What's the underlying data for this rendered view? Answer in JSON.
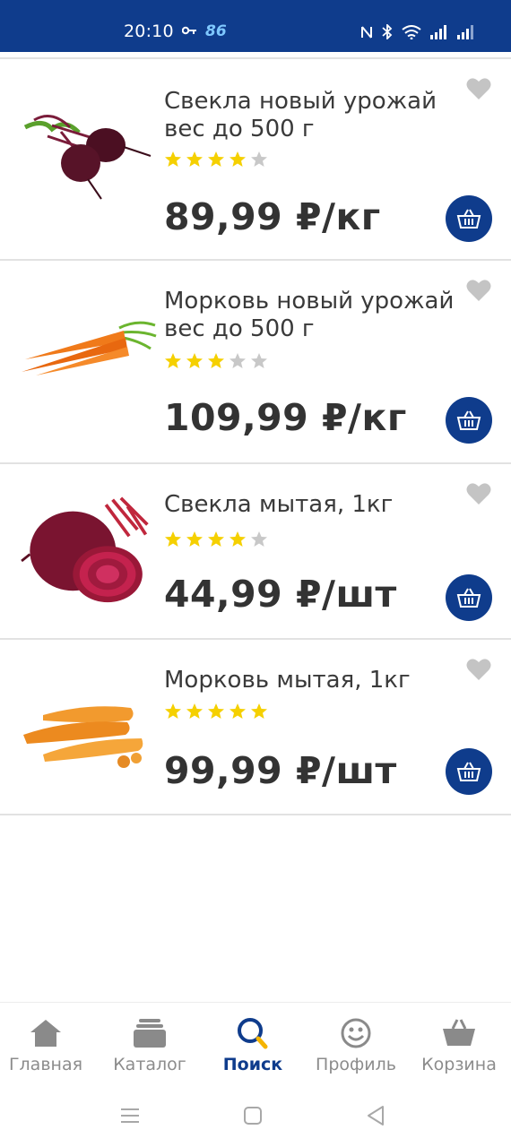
{
  "status_bar": {
    "time": "20:10",
    "speed": "86",
    "icons": [
      "key-icon",
      "nfc-icon",
      "bluetooth-icon",
      "wifi-icon",
      "signal-icon",
      "signal-icon"
    ]
  },
  "products": [
    {
      "name": "Свекла  новый урожай вес до 500 г",
      "price": "89,99 ₽/кг",
      "rating": 4,
      "max_rating": 5,
      "image": "beet-bunch-image"
    },
    {
      "name": "Морковь  новый урожай вес до 500 г",
      "price": "109,99 ₽/кг",
      "rating": 3,
      "max_rating": 5,
      "image": "carrot-bunch-image"
    },
    {
      "name": "Свекла мытая, 1кг",
      "price": "44,99 ₽/шт",
      "rating": 4,
      "max_rating": 5,
      "image": "beet-half-image"
    },
    {
      "name": "Морковь мытая, 1кг",
      "price": "99,99 ₽/шт",
      "rating": 5,
      "max_rating": 5,
      "image": "carrot-pile-image"
    }
  ],
  "bottom_nav": {
    "items": [
      {
        "label": "Главная",
        "icon": "home-icon",
        "active": false
      },
      {
        "label": "Каталог",
        "icon": "catalog-icon",
        "active": false
      },
      {
        "label": "Поиск",
        "icon": "search-icon",
        "active": true
      },
      {
        "label": "Профиль",
        "icon": "profile-icon",
        "active": false
      },
      {
        "label": "Корзина",
        "icon": "basket-icon",
        "active": false
      }
    ]
  },
  "colors": {
    "brand": "#0f3c8c",
    "star_filled": "#f5d000",
    "star_empty": "#c8c8c8",
    "favorite": "#c4c4c4"
  }
}
